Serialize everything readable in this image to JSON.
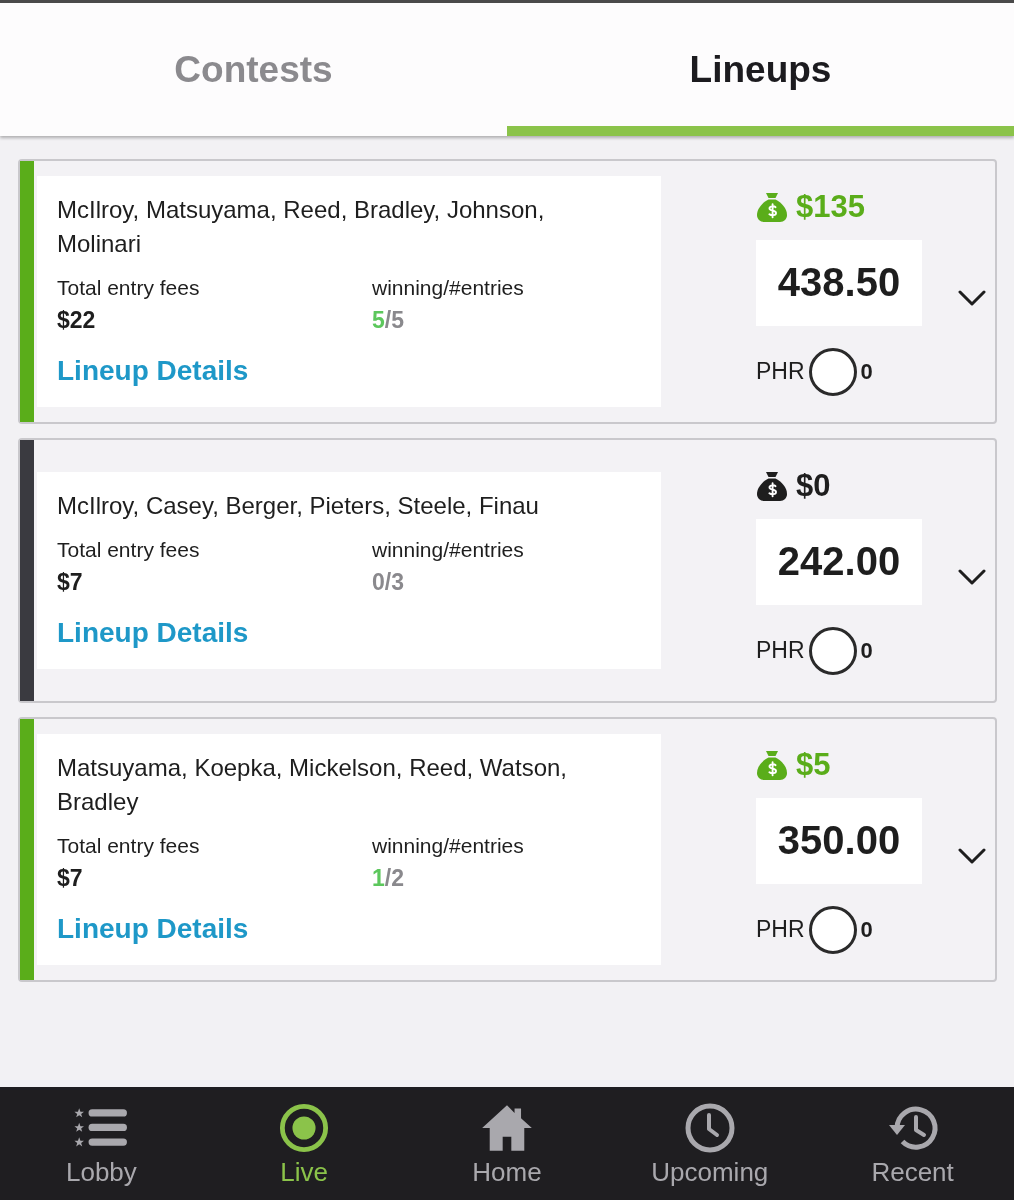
{
  "tabs": [
    {
      "label": "Contests",
      "selected": false
    },
    {
      "label": "Lineups",
      "selected": true
    }
  ],
  "lineups": [
    {
      "players": "McIlroy, Matsuyama, Reed, Bradley, Johnson, Molinari",
      "fees_label": "Total entry fees",
      "fees": "$22",
      "record_label": "winning/#entries",
      "won": "5",
      "of_entries": "/5",
      "link": "Lineup Details",
      "in_the_money": true,
      "prize": "$135",
      "points": "438.50",
      "phr_label": "PHR",
      "phr": "0"
    },
    {
      "players": "McIlroy, Casey, Berger, Pieters, Steele, Finau",
      "fees_label": "Total entry fees",
      "fees": "$7",
      "record_label": "winning/#entries",
      "won": "0",
      "of_entries": "/3",
      "link": "Lineup Details",
      "in_the_money": false,
      "prize": "$0",
      "points": "242.00",
      "phr_label": "PHR",
      "phr": "0"
    },
    {
      "players": "Matsuyama, Koepka, Mickelson, Reed, Watson, Bradley",
      "fees_label": "Total entry fees",
      "fees": "$7",
      "record_label": "winning/#entries",
      "won": "1",
      "of_entries": "/2",
      "link": "Lineup Details",
      "in_the_money": true,
      "prize": "$5",
      "points": "350.00",
      "phr_label": "PHR",
      "phr": "0"
    }
  ],
  "nav": [
    {
      "label": "Lobby",
      "selected": false
    },
    {
      "label": "Live",
      "selected": true
    },
    {
      "label": "Home",
      "selected": false
    },
    {
      "label": "Upcoming",
      "selected": false
    },
    {
      "label": "Recent",
      "selected": false
    }
  ]
}
